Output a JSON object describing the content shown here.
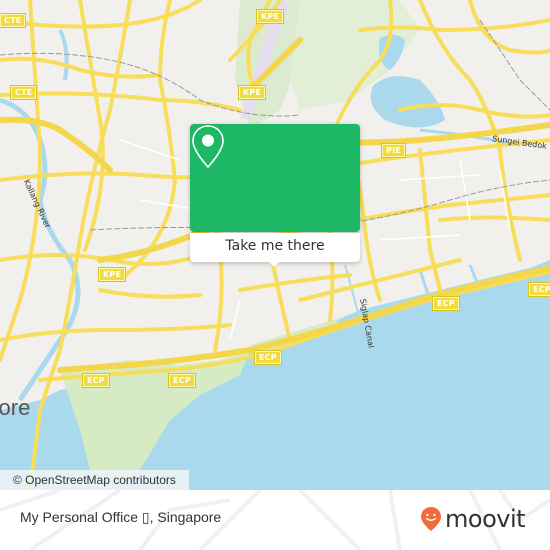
{
  "map": {
    "road_shields": [
      {
        "label": "CTE",
        "id": "cte-1"
      },
      {
        "label": "CTE",
        "id": "cte-2"
      },
      {
        "label": "KPE",
        "id": "kpe-1"
      },
      {
        "label": "KPE",
        "id": "kpe-2"
      },
      {
        "label": "KPE",
        "id": "kpe-3"
      },
      {
        "label": "PIE",
        "id": "pie-1"
      },
      {
        "label": "ECP",
        "id": "ecp-1"
      },
      {
        "label": "ECP",
        "id": "ecp-2"
      },
      {
        "label": "ECP",
        "id": "ecp-3"
      },
      {
        "label": "ECP",
        "id": "ecp-4"
      },
      {
        "label": "ECP",
        "id": "ecp-5"
      }
    ],
    "labels": {
      "kallang_river": "Kallang River",
      "sungei_bedok": "Sungei Bedok",
      "siglap_canal": "Siglap Canal",
      "city": "Singapore"
    },
    "colors": {
      "land": "#f2f0ec",
      "water": "#aad9ee",
      "road": "#f7dd5a",
      "park": "#d6ebc4",
      "accent": "#1db866"
    }
  },
  "popup": {
    "icon": "map-pin-icon",
    "button_label": "Take me there"
  },
  "attribution": "© OpenStreetMap contributors",
  "footer": {
    "place_name": "My Personal Office ▯, Singapore",
    "brand": "moovit",
    "brand_color": "#f26b3a"
  }
}
